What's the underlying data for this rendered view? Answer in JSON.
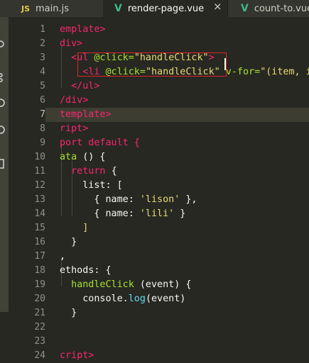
{
  "tabs": [
    {
      "icon": "JS",
      "label": "main.js",
      "active": false
    },
    {
      "icon": "V",
      "label": "render-page.vue",
      "active": true,
      "close": "×"
    },
    {
      "icon": "V",
      "label": "count-to.vue",
      "active": false
    }
  ],
  "editor": {
    "current_line": 7,
    "line_numbers": [
      "1",
      "2",
      "3",
      "4",
      "5",
      "6",
      "7",
      "8",
      "9",
      "10",
      "11",
      "12",
      "13",
      "14",
      "15",
      "16",
      "17",
      "18",
      "19",
      "20",
      "21",
      "22",
      "23",
      "24"
    ],
    "lines": [
      [
        {
          "t": "emplate>",
          "c": "#f92672"
        }
      ],
      [
        {
          "t": "div>",
          "c": "#f92672"
        }
      ],
      [
        {
          "t": "  <ul ",
          "c": "#f92672"
        },
        {
          "t": "@click=",
          "c": "#a6e22e"
        },
        {
          "t": "\"handleClick\"",
          "c": "#e6db74"
        },
        {
          "t": ">",
          "c": "#f92672"
        }
      ],
      [
        {
          "t": "    <li ",
          "c": "#f92672"
        },
        {
          "t": "@click=",
          "c": "#a6e22e"
        },
        {
          "t": "\"handleClick\"",
          "c": "#e6db74"
        },
        {
          "t": " v-for=",
          "c": "#a6e22e"
        },
        {
          "t": "\"(item, ind",
          "c": "#e6db74"
        }
      ],
      [
        {
          "t": "  </ul>",
          "c": "#f92672"
        }
      ],
      [
        {
          "t": "/div>",
          "c": "#f92672"
        }
      ],
      [
        {
          "t": "template>",
          "c": "#f92672"
        }
      ],
      [
        {
          "t": "ript>",
          "c": "#f92672"
        }
      ],
      [
        {
          "t": "port default {",
          "c": "#f92672"
        }
      ],
      [
        {
          "t": "ata ",
          "c": "#a6e22e"
        },
        {
          "t": "() {",
          "c": "#f8f8f2"
        }
      ],
      [
        {
          "t": "  return ",
          "c": "#f92672"
        },
        {
          "t": "{",
          "c": "#f8f8f2"
        }
      ],
      [
        {
          "t": "    list: [",
          "c": "#f8f8f2"
        }
      ],
      [
        {
          "t": "      { name: ",
          "c": "#f8f8f2"
        },
        {
          "t": "'lison'",
          "c": "#e6db74"
        },
        {
          "t": " },",
          "c": "#f8f8f2"
        }
      ],
      [
        {
          "t": "      { name: ",
          "c": "#f8f8f2"
        },
        {
          "t": "'lili'",
          "c": "#e6db74"
        },
        {
          "t": " }",
          "c": "#f8f8f2"
        }
      ],
      [
        {
          "t": "    ]",
          "c": "#e6db74"
        }
      ],
      [
        {
          "t": "  }",
          "c": "#f8f8f2"
        }
      ],
      [
        {
          "t": ",",
          "c": "#f8f8f2"
        }
      ],
      [
        {
          "t": "ethods: {",
          "c": "#f8f8f2"
        }
      ],
      [
        {
          "t": "  handleClick ",
          "c": "#a6e22e"
        },
        {
          "t": "(event) {",
          "c": "#f8f8f2"
        }
      ],
      [
        {
          "t": "    console.",
          "c": "#f8f8f2"
        },
        {
          "t": "log",
          "c": "#66d9ef"
        },
        {
          "t": "(event)",
          "c": "#f8f8f2"
        }
      ],
      [
        {
          "t": "  }",
          "c": "#f8f8f2"
        }
      ],
      [
        {
          "t": "",
          "c": "#f8f8f2"
        }
      ],
      [
        {
          "t": "",
          "c": "#f8f8f2"
        }
      ],
      [
        {
          "t": "cript>",
          "c": "#f92672"
        }
      ]
    ]
  }
}
